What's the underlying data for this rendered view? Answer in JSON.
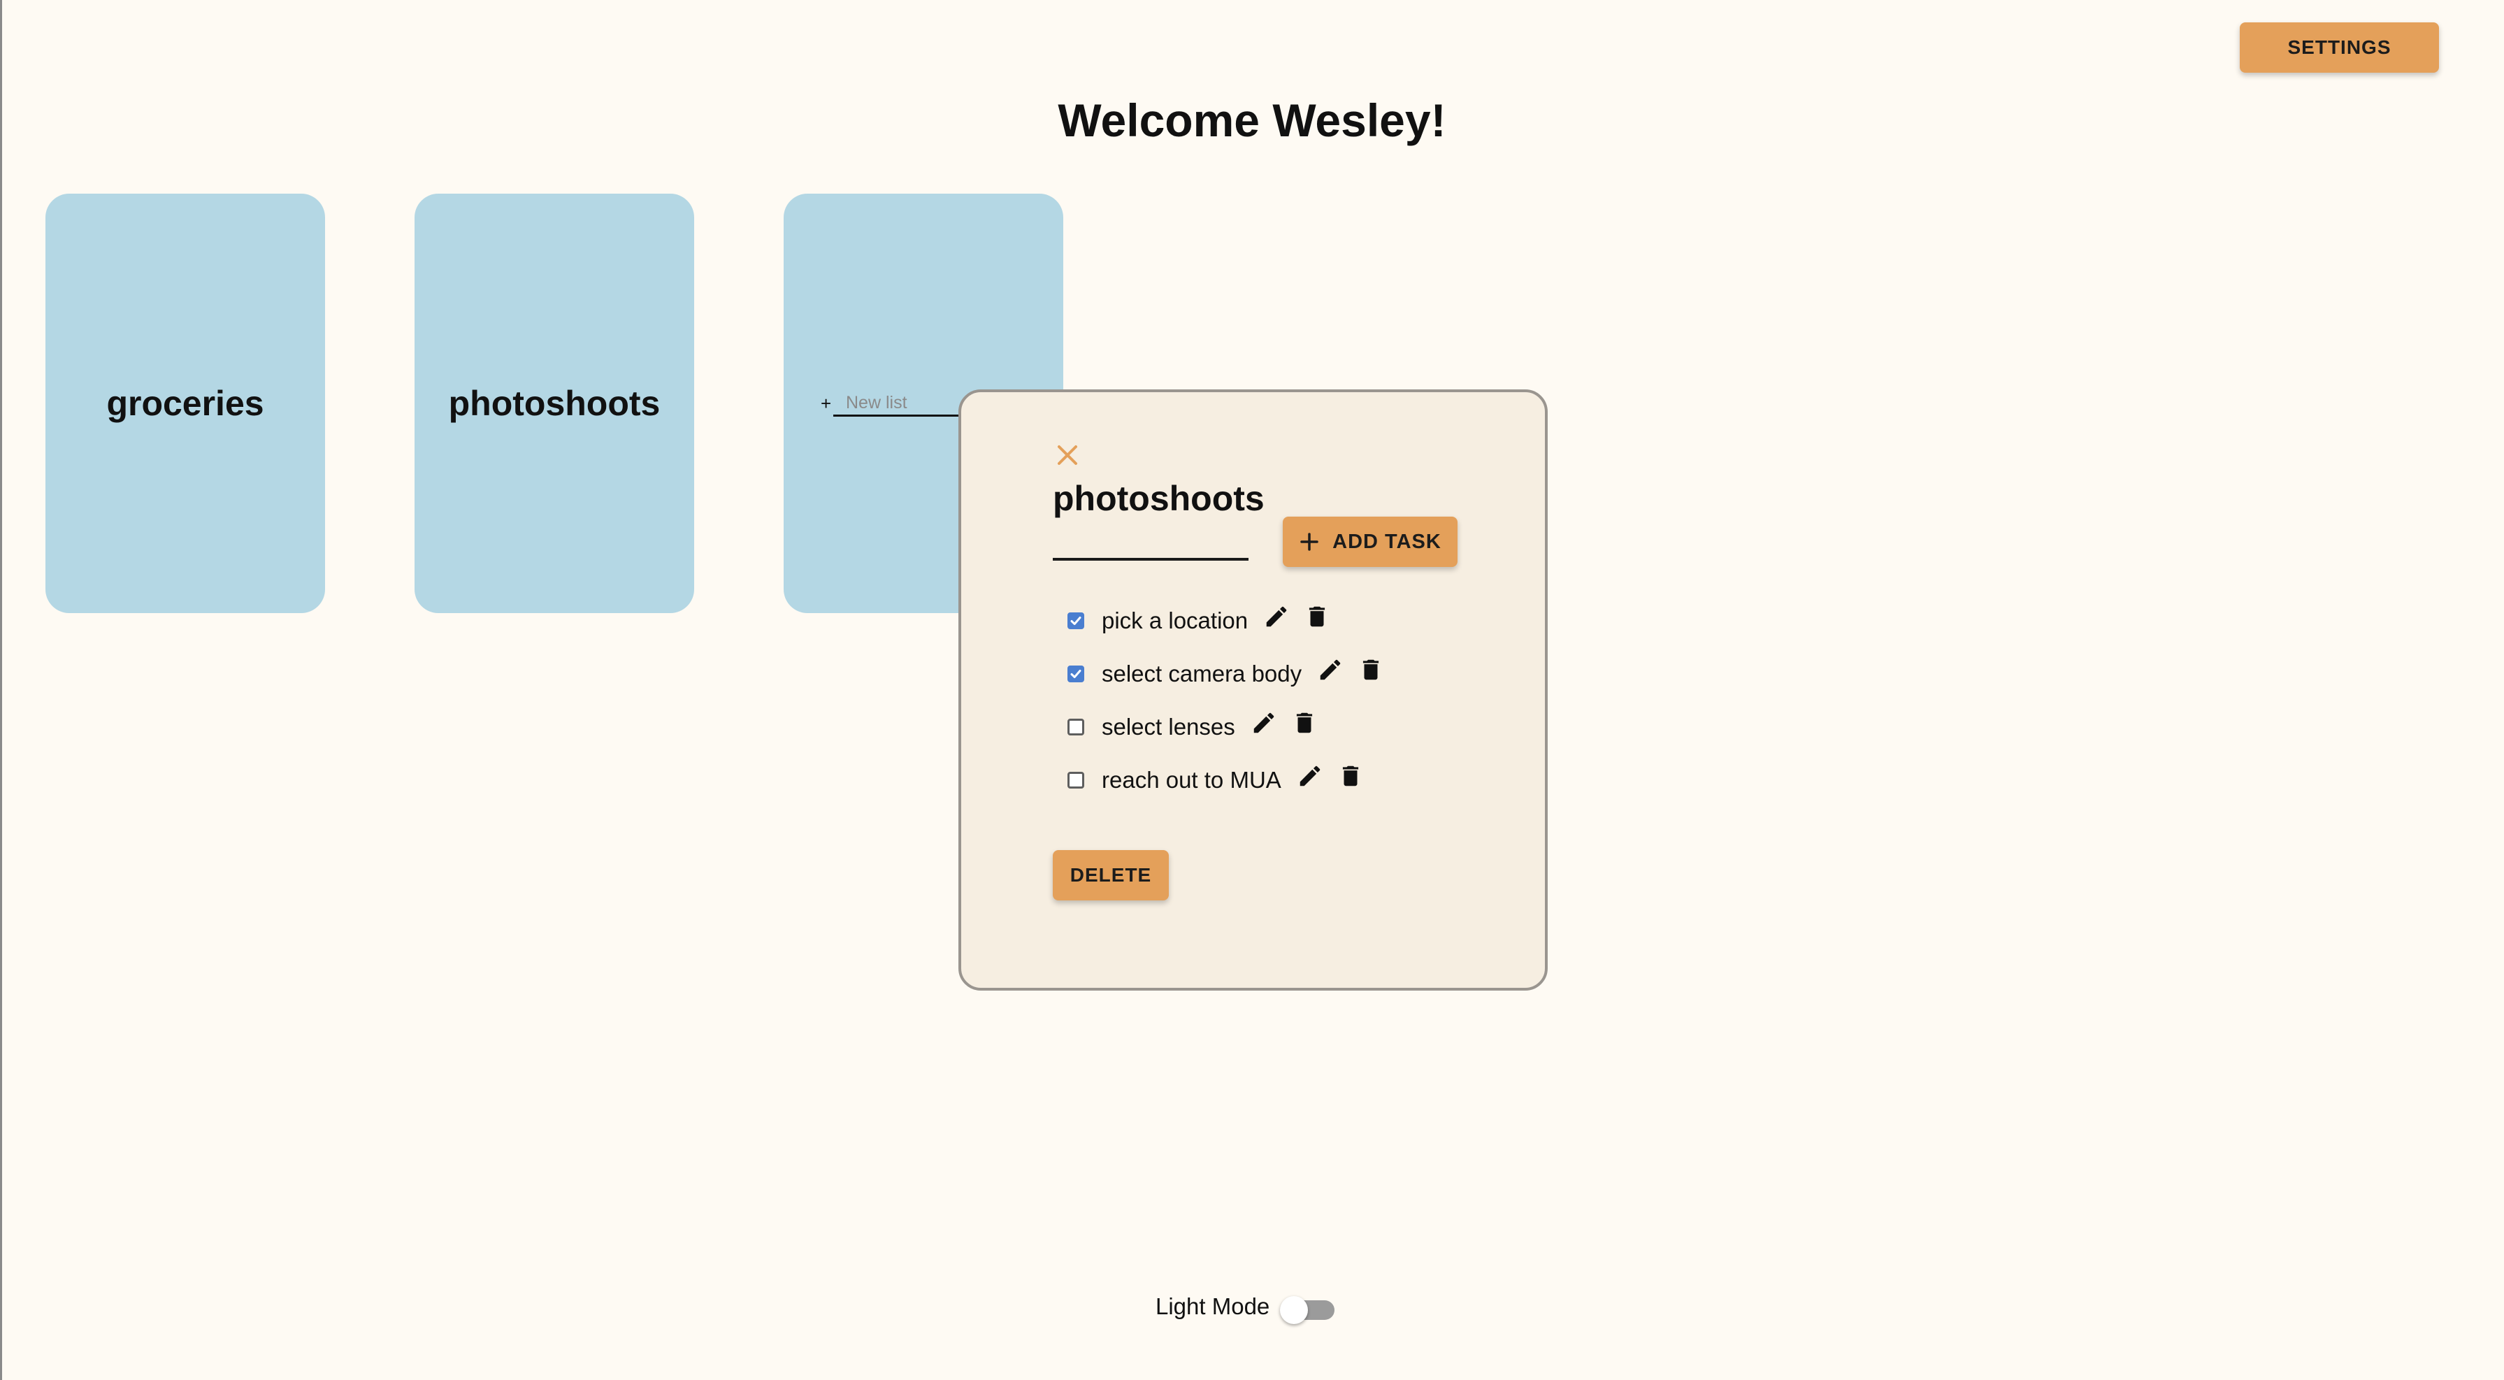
{
  "header": {
    "settings_label": "SETTINGS",
    "welcome_text": "Welcome Wesley!"
  },
  "lists": [
    {
      "name": "groceries"
    },
    {
      "name": "photoshoots"
    }
  ],
  "new_list": {
    "plus": "+",
    "placeholder": "New list"
  },
  "modal": {
    "title": "photoshoots",
    "add_task_label": "ADD TASK",
    "delete_label": "DELETE",
    "tasks": [
      {
        "label": "pick a location",
        "checked": true
      },
      {
        "label": "select camera body",
        "checked": true
      },
      {
        "label": "select lenses",
        "checked": false
      },
      {
        "label": "reach out to MUA",
        "checked": false
      }
    ]
  },
  "footer": {
    "mode_label": "Light Mode",
    "dark_mode_on": false
  },
  "colors": {
    "accent": "#e4a05a",
    "card": "#b4d7e4",
    "modal_bg": "#f6eee1",
    "checkbox": "#4a7ed0",
    "background": "#fefaf3"
  },
  "icons": [
    "close-icon",
    "plus-icon",
    "pencil-icon",
    "trash-icon"
  ]
}
